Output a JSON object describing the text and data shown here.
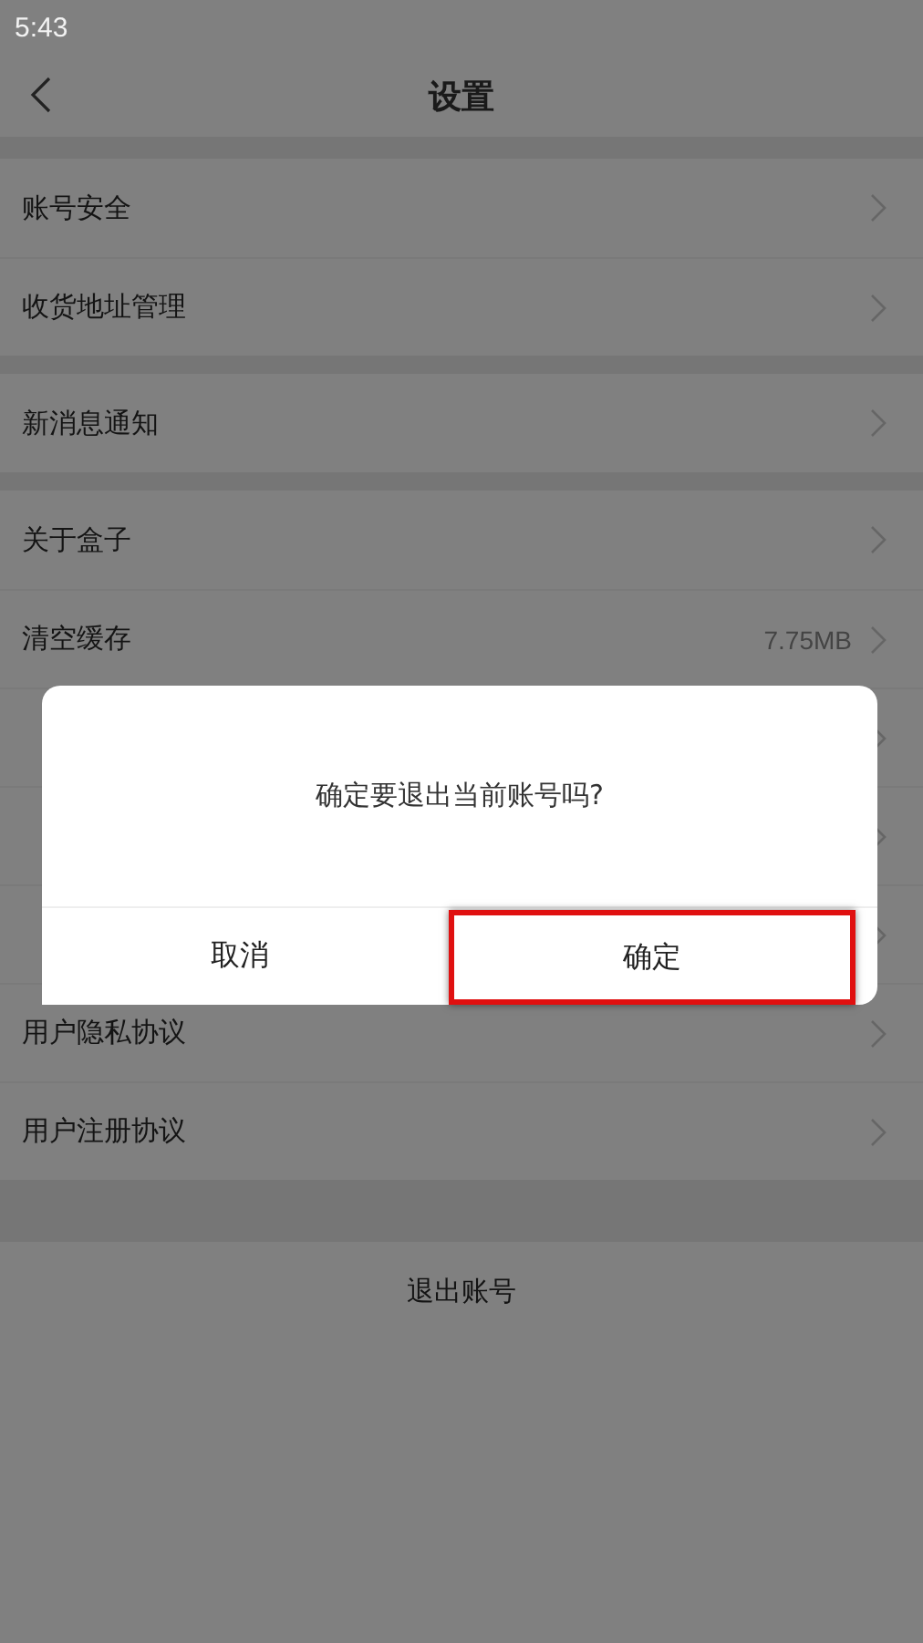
{
  "status_bar": {
    "time": "5:43"
  },
  "header": {
    "title": "设置"
  },
  "groups": [
    {
      "items": [
        {
          "kind": "link",
          "label": "账号安全"
        },
        {
          "kind": "link",
          "label": "收货地址管理"
        }
      ]
    },
    {
      "items": [
        {
          "kind": "link",
          "label": "新消息通知"
        }
      ]
    },
    {
      "items": [
        {
          "kind": "link",
          "label": "关于盒子"
        },
        {
          "kind": "link",
          "label": "清空缓存",
          "value": "7.75MB"
        },
        {
          "kind": "covered"
        },
        {
          "kind": "covered"
        },
        {
          "kind": "covered"
        },
        {
          "kind": "link",
          "label": "用户隐私协议"
        },
        {
          "kind": "link",
          "label": "用户注册协议"
        }
      ]
    }
  ],
  "logout_button": {
    "label": "退出账号"
  },
  "dialog": {
    "message": "确定要退出当前账号吗?",
    "buttons": [
      {
        "label": "取消",
        "highlighted": false
      },
      {
        "label": "确定",
        "highlighted": true
      }
    ]
  }
}
